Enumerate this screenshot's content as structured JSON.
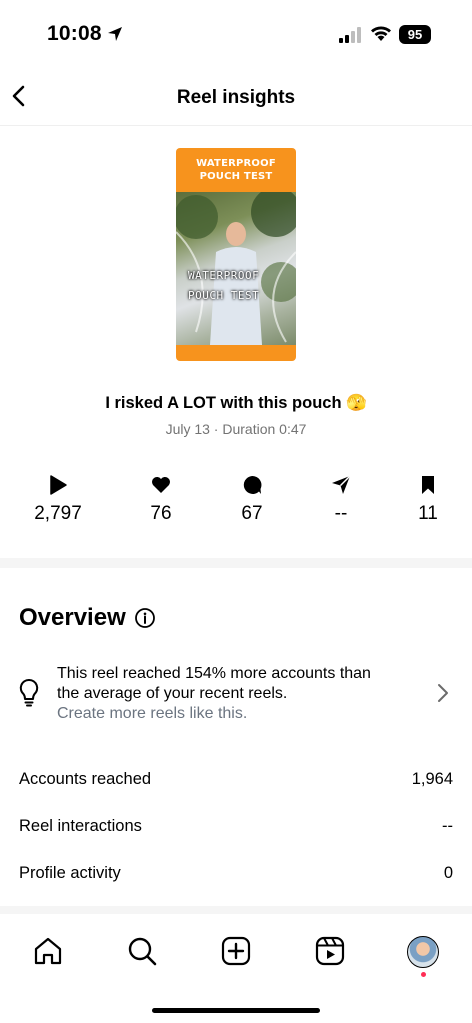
{
  "status_bar": {
    "time": "10:08",
    "battery": "95"
  },
  "header": {
    "title": "Reel insights"
  },
  "thumbnail": {
    "banner_text": "WATERPROOF POUCH TEST",
    "overlay_line1": "WATERPROOF",
    "overlay_line2": "POUCH TEST",
    "accent_color": "#f7931d"
  },
  "reel": {
    "title": "I risked A LOT with this pouch 🫣",
    "meta": "July 13 · Duration 0:47"
  },
  "stats": [
    {
      "icon": "play-icon",
      "value": "2,797"
    },
    {
      "icon": "heart-icon",
      "value": "76"
    },
    {
      "icon": "comment-icon",
      "value": "67"
    },
    {
      "icon": "share-icon",
      "value": "--"
    },
    {
      "icon": "bookmark-icon",
      "value": "11"
    }
  ],
  "overview": {
    "title": "Overview",
    "tip_line1": "This reel reached 154% more accounts than",
    "tip_line2": "the average of your recent reels.",
    "tip_link": "Create more reels like this.",
    "metrics": [
      {
        "label": "Accounts reached",
        "value": "1,964"
      },
      {
        "label": "Reel interactions",
        "value": "--"
      },
      {
        "label": "Profile activity",
        "value": "0"
      }
    ]
  },
  "tabbar": {
    "items": [
      "home-icon",
      "search-icon",
      "create-icon",
      "reels-icon",
      "profile-avatar"
    ]
  }
}
